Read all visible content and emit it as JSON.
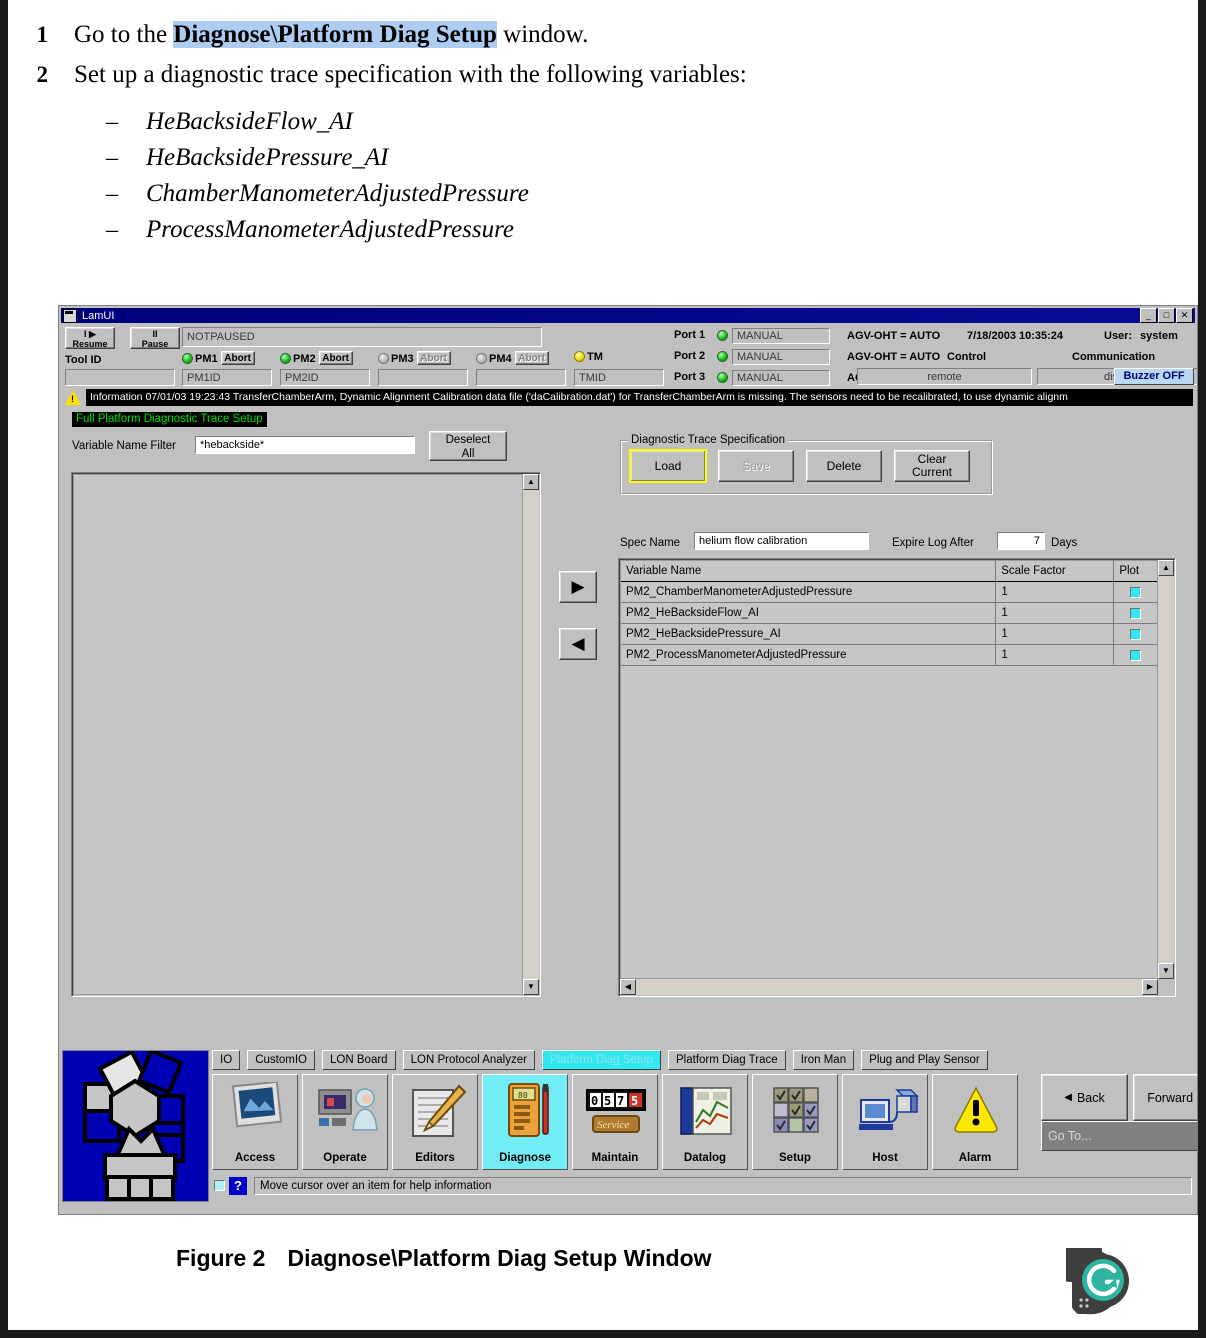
{
  "document": {
    "steps": [
      {
        "num": "1",
        "pre": "Go to the ",
        "bold": "Diagnose\\Platform Diag Setup",
        "post": " window."
      },
      {
        "num": "2",
        "pre": "Set up a diagnostic trace specification with the following variables:",
        "bold": "",
        "post": ""
      }
    ],
    "bullets": [
      "HeBacksideFlow_AI",
      "HeBacksidePressure_AI",
      "ChamberManometerAdjustedPressure",
      "ProcessManometerAdjustedPressure"
    ],
    "dash": "–",
    "figure_caption_label": "Figure 2",
    "figure_caption_text": "Diagnose\\Platform Diag Setup Window"
  },
  "window": {
    "title": "LamUI",
    "buttons": {
      "minimize": "_",
      "maximize": "□",
      "close": "✕"
    }
  },
  "header": {
    "resume_label": "I ▶\nResume",
    "resume_line1": "I ▶",
    "resume_line2": "Resume",
    "pause_line1": "II",
    "pause_line2": "Pause",
    "status_value": "NOTPAUSED",
    "tool_id_label": "Tool ID",
    "tool_id_value": "",
    "modules": [
      {
        "name": "PM1",
        "abort": "Abort",
        "led": "green",
        "abort_enabled": true,
        "id": "PM1ID"
      },
      {
        "name": "PM2",
        "abort": "Abort",
        "led": "green",
        "abort_enabled": true,
        "id": "PM2ID"
      },
      {
        "name": "PM3",
        "abort": "Abort",
        "led": "off",
        "abort_enabled": false,
        "id": ""
      },
      {
        "name": "PM4",
        "abort": "Abort",
        "led": "off",
        "abort_enabled": false,
        "id": ""
      },
      {
        "name": "TM",
        "abort": "",
        "led": "yellow",
        "abort_enabled": false,
        "id": "TMID"
      }
    ],
    "ports": [
      {
        "label": "Port 1",
        "value": "MANUAL",
        "agv": "AGV-OHT = AUTO"
      },
      {
        "label": "Port 2",
        "value": "MANUAL",
        "agv": "AGV-OHT = AUTO"
      },
      {
        "label": "Port 3",
        "value": "MANUAL",
        "agv": "AGV-OHT = AUTO"
      }
    ],
    "datetime": "7/18/2003  10:35:24",
    "user_label": "User:",
    "user_value": "system",
    "control_label": "Control",
    "control_value": "remote",
    "communication_label": "Communication",
    "communication_value": "disabled",
    "buzzer_label": "Buzzer OFF"
  },
  "infobar": {
    "text": "Information 07/01/03 19:23:43 TransferChamberArm, Dynamic Alignment Calibration data file ('daCalibration.dat') for TransferChamberArm is missing.  The sensors need to be recalibrated, to use dynamic alignm"
  },
  "main": {
    "screen_title": "Full Platform Diagnostic Trace Setup",
    "filter_label": "Variable Name Filter",
    "filter_value": "*hebackside*",
    "deselect_line1": "Deselect",
    "deselect_line2": "All",
    "add_arrow": "▶",
    "remove_arrow": "◀",
    "group": {
      "title": "Diagnostic Trace Specification",
      "buttons": [
        {
          "label": "Load",
          "enabled": true,
          "focused": true,
          "line2": ""
        },
        {
          "label": "Save",
          "enabled": false,
          "focused": false,
          "line2": ""
        },
        {
          "label": "Delete",
          "enabled": true,
          "focused": false,
          "line2": ""
        },
        {
          "label": "Clear",
          "enabled": true,
          "focused": false,
          "line2": "Current"
        }
      ]
    },
    "spec_name_label": "Spec Name",
    "spec_name_value": "helium flow calibration",
    "expire_label": "Expire Log After",
    "expire_value": "7",
    "days_label": "Days",
    "table": {
      "columns": [
        "Variable Name",
        "Scale Factor",
        "Plot"
      ],
      "rows": [
        {
          "name": "PM2_ChamberManometerAdjustedPressure",
          "scale": "1",
          "plot": true
        },
        {
          "name": "PM2_HeBacksideFlow_AI",
          "scale": "1",
          "plot": true
        },
        {
          "name": "PM2_HeBacksidePressure_AI",
          "scale": "1",
          "plot": true
        },
        {
          "name": "PM2_ProcessManometerAdjustedPressure",
          "scale": "1",
          "plot": true
        }
      ]
    }
  },
  "nav": {
    "tabs": [
      {
        "label": "IO",
        "selected": false
      },
      {
        "label": "CustomIO",
        "selected": false
      },
      {
        "label": "LON Board",
        "selected": false
      },
      {
        "label": "LON Protocol Analyzer",
        "selected": false
      },
      {
        "label": "Platform Diag Setup",
        "selected": true
      },
      {
        "label": "Platform Diag Trace",
        "selected": false
      },
      {
        "label": "Iron Man",
        "selected": false
      },
      {
        "label": "Plug and Play Sensor",
        "selected": false
      }
    ],
    "icons": [
      {
        "label": "Access",
        "selected": false,
        "icon": "monitor-photo-icon"
      },
      {
        "label": "Operate",
        "selected": false,
        "icon": "operator-icon"
      },
      {
        "label": "Editors",
        "selected": false,
        "icon": "clipboard-pencil-icon"
      },
      {
        "label": "Diagnose",
        "selected": true,
        "icon": "multimeter-icon"
      },
      {
        "label": "Maintain",
        "selected": false,
        "icon": "odometer-service-icon"
      },
      {
        "label": "Datalog",
        "selected": false,
        "icon": "chart-book-icon"
      },
      {
        "label": "Setup",
        "selected": false,
        "icon": "grid-checks-icon"
      },
      {
        "label": "Host",
        "selected": false,
        "icon": "computer-network-icon"
      },
      {
        "label": "Alarm",
        "selected": false,
        "icon": "warning-triangle-icon"
      }
    ],
    "back_label": "Back",
    "forward_label": "Forward",
    "back_arrow": "◀",
    "forward_arrow": "▶",
    "goto_label": "Go To...",
    "goto_dash": "—"
  },
  "statusbar": {
    "help_glyph": "?",
    "text": "Move cursor over an item for help information"
  },
  "colors": {
    "accent_cyan": "#30e8ef",
    "titlebar_blue": "#00007b",
    "focus_yellow": "#ffff00",
    "logo_blue": "#0000b5",
    "green_text": "#00e000",
    "highlight": "#aecbf0"
  }
}
